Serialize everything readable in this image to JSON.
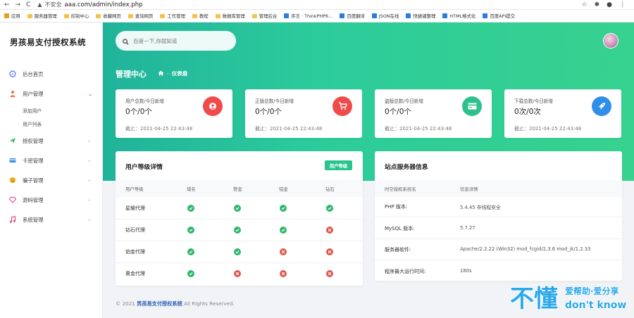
{
  "browser": {
    "back": "←",
    "forward": "→",
    "reload": "C",
    "security_text": "不安全",
    "url": "aaa.com/admin/index.php",
    "icons": [
      "star-icon",
      "extensions-icon",
      "profile-icon",
      "menu-icon"
    ]
  },
  "bookmarks": [
    {
      "label": "应用",
      "icon": "apps-icon"
    },
    {
      "label": "服务器管理",
      "icon": "folder-icon"
    },
    {
      "label": "控制中心",
      "icon": "folder-icon"
    },
    {
      "label": "收藏网页",
      "icon": "folder-icon"
    },
    {
      "label": "查询网页",
      "icon": "folder-icon"
    },
    {
      "label": "工作管理",
      "icon": "folder-icon"
    },
    {
      "label": "教程",
      "icon": "folder-icon"
    },
    {
      "label": "数据库管理",
      "icon": "folder-icon"
    },
    {
      "label": "管理后台",
      "icon": "folder-icon"
    },
    {
      "label": "序言 · ThinkPHP6...",
      "icon": "page-icon"
    },
    {
      "label": "百度翻译",
      "icon": "translate-icon"
    },
    {
      "label": "JSON在线",
      "icon": "tool-icon"
    },
    {
      "label": "快捷键整理",
      "icon": "page-icon"
    },
    {
      "label": "HTML格式化",
      "icon": "tool-icon"
    },
    {
      "label": "百度API提交",
      "icon": "page-icon"
    }
  ],
  "sidebar": {
    "brand": "男孩易支付授权系统",
    "items": [
      {
        "label": "后台首页",
        "icon": "compass-icon",
        "color": "#4a6cf7",
        "has_children": false
      },
      {
        "label": "用户管理",
        "icon": "user-icon",
        "color": "#f07c4a",
        "has_children": true,
        "expanded": true,
        "children": [
          "添加用户",
          "用户列表"
        ]
      },
      {
        "label": "授权管理",
        "icon": "send-icon",
        "color": "#2fb86c",
        "has_children": true
      },
      {
        "label": "卡密管理",
        "icon": "card-icon",
        "color": "#3a8ee6",
        "has_children": true
      },
      {
        "label": "骗子管理",
        "icon": "smile-icon",
        "color": "#f5b82e",
        "has_children": true
      },
      {
        "label": "源码管理",
        "icon": "diamond-icon",
        "color": "#e05c9b",
        "has_children": true
      },
      {
        "label": "系统管理",
        "icon": "music-icon",
        "color": "#e14b7a",
        "has_children": true
      }
    ]
  },
  "header": {
    "search_placeholder": "百度一下,你就知道",
    "title": "管理中心",
    "breadcrumb": "仪表盘"
  },
  "stats": [
    {
      "label": "用户总数/今日新增",
      "value": "0个/0个",
      "date": "截止：2021-04-25 22:43:48",
      "icon": "user-circle-icon",
      "color": "#ef4b4b"
    },
    {
      "label": "正版总数/今日新增",
      "value": "0个/0个",
      "date": "截止：2021-04-25 22:43:48",
      "icon": "cart-icon",
      "color": "#ef4b4b"
    },
    {
      "label": "盗版总数/今日新增",
      "value": "0个/0个",
      "date": "截止：2021-04-25 22:43:48",
      "icon": "card-icon",
      "color": "#2fc18b"
    },
    {
      "label": "下载总数/今日新增",
      "value": "0次/0次",
      "date": "截止：2021-04-25 22:43:48",
      "icon": "rocket-icon",
      "color": "#2f8fe8"
    }
  ],
  "user_levels": {
    "title": "用户等级详情",
    "button": "用户等级",
    "columns": [
      "用户等级",
      "域名",
      "赞金",
      "铂金",
      "钻石"
    ],
    "rows": [
      {
        "name": "星耀代理",
        "flags": [
          true,
          true,
          true,
          true
        ]
      },
      {
        "name": "钻石代理",
        "flags": [
          true,
          true,
          true,
          false
        ]
      },
      {
        "name": "铂金代理",
        "flags": [
          true,
          true,
          false,
          false
        ]
      },
      {
        "name": "黄金代理",
        "flags": [
          true,
          false,
          false,
          false
        ]
      }
    ]
  },
  "server_info": {
    "title": "站点服务器信息",
    "columns": [
      "时空授权系统名",
      "信息详情"
    ],
    "rows": [
      {
        "key": "PHP 版本:",
        "value": "5.4.45 非线程安全"
      },
      {
        "key": "MySQL 版本:",
        "value": "5.7.27"
      },
      {
        "key": "服务器软件:",
        "value": "Apache/2.2.22 (Win32) mod_fcgid/2.3.6 mod_jk/1.2.33"
      },
      {
        "key": "程序最大运行时间:",
        "value": "180s"
      }
    ]
  },
  "footer": {
    "prefix": "© 2021",
    "link": "男孩易支付授权系统",
    "suffix": "All Rights Reserved."
  },
  "watermark": {
    "big": "不懂",
    "top": "爱帮助·爱分享",
    "bottom": "don't know"
  }
}
